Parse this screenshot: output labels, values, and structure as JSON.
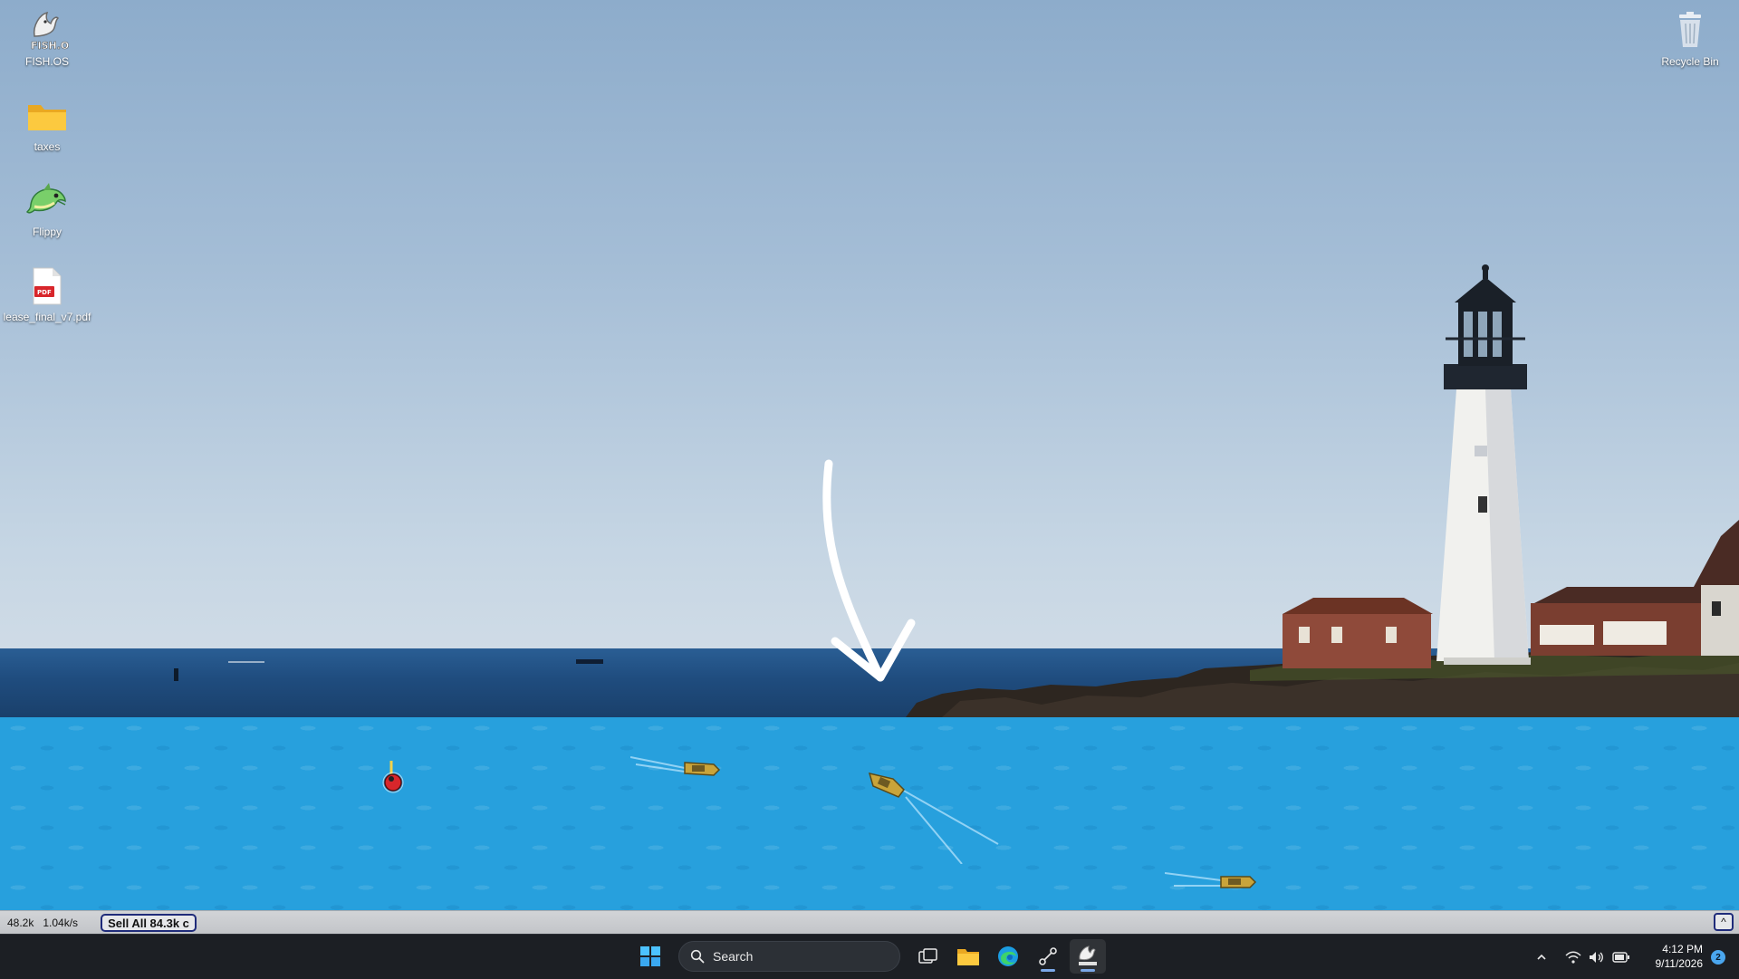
{
  "desktop": {
    "icons": [
      {
        "label": "FISH.OS",
        "icon": "fishos-logo-icon",
        "logo_text": "FISH.OS"
      },
      {
        "label": "taxes",
        "icon": "folder-icon"
      },
      {
        "label": "Flippy",
        "icon": "dolphin-icon"
      },
      {
        "label": "lease_final_v7.pdf",
        "icon": "pdf-file-icon",
        "badge": "PDF"
      },
      {
        "label": "Recycle Bin",
        "icon": "recycle-bin-icon"
      }
    ]
  },
  "game": {
    "coins": "48.2k",
    "rate": "1.04k/s",
    "sell_all_label": "Sell All 84.3k c",
    "collapse_label": "^",
    "water_color": "#27a0dd",
    "boats": [
      "fishing-boat",
      "fishing-boat",
      "fishing-boat",
      "fishing-buoy"
    ]
  },
  "taskbar": {
    "search_placeholder": "Search",
    "apps": [
      "start-icon",
      "task-view-icon",
      "file-explorer-icon",
      "edge-icon",
      "network-app-icon",
      "fishos-app-icon"
    ],
    "time": "4:12 PM",
    "date": "9/11/2026",
    "notification_count": "2",
    "accent_color": "#7aa7e8"
  }
}
